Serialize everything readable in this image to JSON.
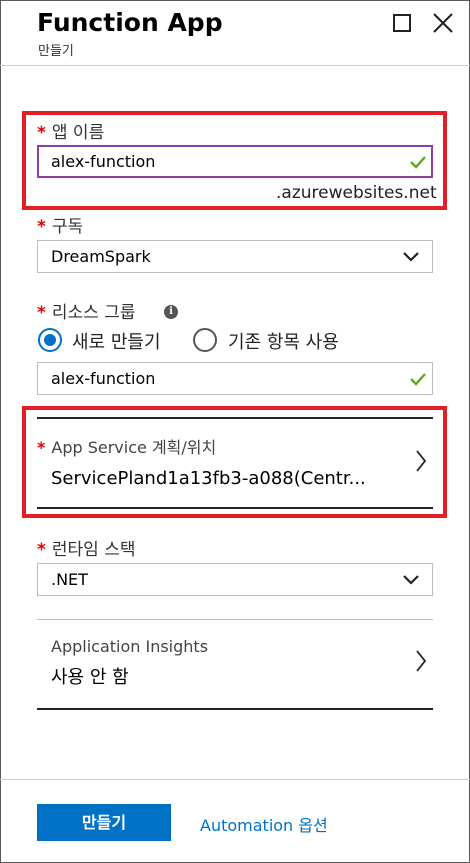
{
  "header": {
    "title": "Function App",
    "subtitle": "만들기"
  },
  "app_name": {
    "required_mark": "*",
    "label": "앱 이름",
    "value": "alex-function",
    "suffix": ".azurewebsites.net"
  },
  "subscription": {
    "required_mark": "*",
    "label": "구독",
    "value": "DreamSpark"
  },
  "resource_group": {
    "required_mark": "*",
    "label": "리소스 그룹",
    "info_glyph": "i",
    "option_new": "새로 만들기",
    "option_existing": "기존 항목 사용",
    "selected": "new",
    "value": "alex-function"
  },
  "app_service": {
    "required_mark": "*",
    "label": "App Service 계획/위치",
    "value": "ServicePland1a13fb3-a088(Centr..."
  },
  "runtime": {
    "required_mark": "*",
    "label": "런타임 스택",
    "value": ".NET"
  },
  "app_insights": {
    "label": "Application Insights",
    "value": "사용 안 함"
  },
  "footer": {
    "create_label": "만들기",
    "automation_label": "Automation 옵션"
  },
  "colors": {
    "accent": "#0072c6",
    "highlight_box": "#e21f26",
    "focus_border": "#8a3fa6",
    "valid_check": "#5fa81e"
  },
  "icons": [
    "maximize-icon",
    "close-icon",
    "check-icon",
    "chevron-down-icon",
    "chevron-right-icon",
    "info-icon"
  ]
}
